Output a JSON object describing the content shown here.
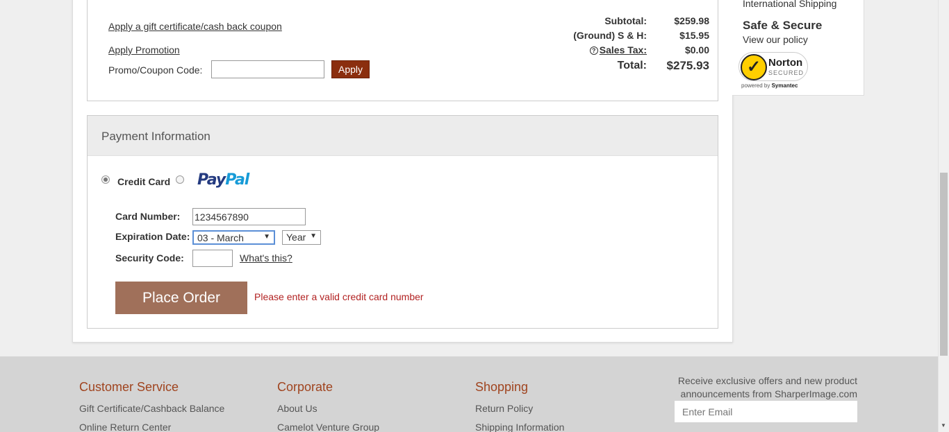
{
  "promo": {
    "gift_link": "Apply a gift certificate/cash back coupon",
    "promotion_link": "Apply Promotion",
    "code_label": "Promo/Coupon Code:",
    "code_value": "",
    "apply_label": "Apply"
  },
  "totals": {
    "subtotal_label": "Subtotal:",
    "subtotal_value": "$259.98",
    "shipping_label": "(Ground) S & H:",
    "shipping_value": "$15.95",
    "tax_icon": "?",
    "tax_label": "Sales Tax:",
    "tax_value": "$0.00",
    "total_label": "Total:",
    "total_value": "$275.93"
  },
  "payment": {
    "header": "Payment Information",
    "credit_card_label": "Credit Card",
    "credit_card_selected": true,
    "paypal_part1": "Pay",
    "paypal_part2": "Pal",
    "card_number_label": "Card Number:",
    "card_number_value": "1234567890",
    "expiration_label": "Expiration Date:",
    "month_value": "03 - March",
    "year_value": "Year",
    "security_label": "Security Code:",
    "security_value": "",
    "whats_this": "What's this?",
    "place_order": "Place Order",
    "error": "Please enter a valid credit card number"
  },
  "sidebar": {
    "intl_shipping": "International Shipping",
    "safe_title": "Safe & Secure",
    "policy_link": "View our policy",
    "norton_check": "✓",
    "norton_name": "Norton",
    "norton_secured": "SECURED",
    "norton_powered": "powered by",
    "norton_symantec": "Symantec"
  },
  "footer": {
    "customer_service": {
      "title": "Customer Service",
      "links": [
        "Gift Certificate/Cashback Balance",
        "Online Return Center"
      ]
    },
    "corporate": {
      "title": "Corporate",
      "links": [
        "About Us",
        "Camelot Venture Group"
      ]
    },
    "shopping": {
      "title": "Shopping",
      "links": [
        "Return Policy",
        "Shipping Information"
      ]
    },
    "newsletter_text": "Receive exclusive offers and new product announcements from SharperImage.com",
    "email_placeholder": "Enter Email"
  },
  "colors": {
    "accent": "#8b2e0e",
    "place_order": "#a0705a",
    "error": "#b22222",
    "footer_heading": "#a0441f"
  }
}
